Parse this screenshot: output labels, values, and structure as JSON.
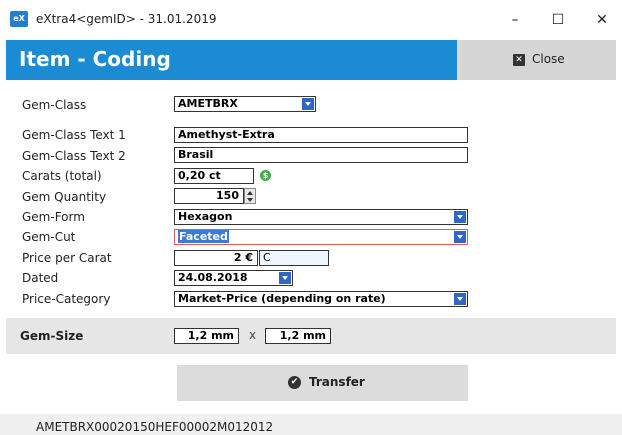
{
  "window": {
    "title": "eXtra4<gemID>  -  31.01.2019",
    "app_icon_text": "eX",
    "minimize": "–",
    "maximize": "☐",
    "close": "✕"
  },
  "header": {
    "title": "Item - Coding",
    "close_label": "Close",
    "close_icon_glyph": "✕",
    "color": "#1b8cd3"
  },
  "form": {
    "labels": {
      "gem_class": "Gem-Class",
      "gem_class_text1": "Gem-Class Text 1",
      "gem_class_text2": "Gem-Class Text 2",
      "carats": "Carats (total)",
      "gem_quantity": "Gem Quantity",
      "gem_form": "Gem-Form",
      "gem_cut": "Gem-Cut",
      "price_per_carat": "Price per Carat",
      "dated": "Dated",
      "price_category": "Price-Category"
    },
    "values": {
      "gem_class": "AMETBRX",
      "gem_class_text1": "Amethyst-Extra",
      "gem_class_text2": "Brasil",
      "carats": "0,20 ct",
      "gem_quantity": "150",
      "gem_form": "Hexagon",
      "gem_cut": "Faceted",
      "price_per_carat": "2 €",
      "price_code": "C",
      "dated": "24.08.2018",
      "price_category": "Market-Price (depending on rate)"
    },
    "carat_badge": "$"
  },
  "gem_size": {
    "label": "Gem-Size",
    "width": "1,2 mm",
    "height": "1,2 mm",
    "separator": "x"
  },
  "transfer": {
    "label": "Transfer",
    "icon_glyph": "✔"
  },
  "status": {
    "text": "AMETBRX00020150HEF00002M012012"
  }
}
